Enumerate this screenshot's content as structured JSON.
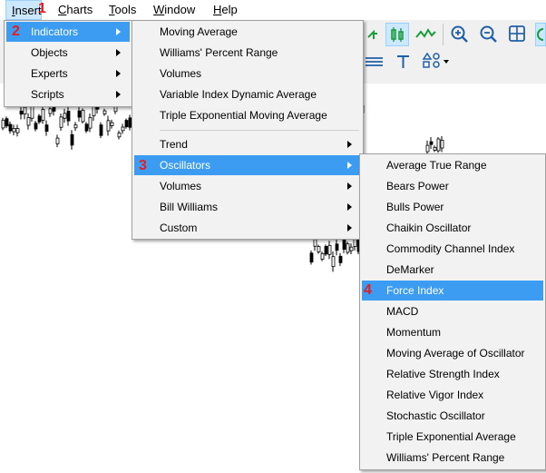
{
  "menubar": {
    "items": [
      {
        "first": "I",
        "rest": "nsert"
      },
      {
        "first": "C",
        "rest": "harts"
      },
      {
        "first": "T",
        "rest": "ools"
      },
      {
        "first": "W",
        "rest": "indow"
      },
      {
        "first": "H",
        "rest": "elp"
      }
    ]
  },
  "steps": [
    "1",
    "2",
    "3",
    "4"
  ],
  "insert_menu": {
    "items": [
      "Indicators",
      "Objects",
      "Experts",
      "Scripts"
    ]
  },
  "indicators_menu": {
    "top_items": [
      "Moving Average",
      "Williams' Percent Range",
      "Volumes",
      "Variable Index Dynamic Average",
      "Triple Exponential Moving Average"
    ],
    "group_items": [
      "Trend",
      "Oscillators",
      "Volumes",
      "Bill Williams",
      "Custom"
    ]
  },
  "oscillators_menu": {
    "items": [
      "Average True Range",
      "Bears Power",
      "Bulls Power",
      "Chaikin Oscillator",
      "Commodity Channel Index",
      "DeMarker",
      "Force Index",
      "MACD",
      "Momentum",
      "Moving Average of Oscillator",
      "Relative Strength Index",
      "Relative Vigor Index",
      "Stochastic Oscillator",
      "Triple Exponential Average",
      "Williams' Percent Range"
    ]
  },
  "toolbar": {
    "icons": [
      "candlestick-icon",
      "line-chart-icon",
      "zoom-in-icon",
      "zoom-out-icon",
      "grid-icon",
      "horizontal-lines-icon",
      "text-tool-icon",
      "shapes-icon"
    ]
  },
  "colors": {
    "highlight": "#3c9cf2",
    "step_marker": "#e81c1c",
    "menu_bg": "#f2f2f2",
    "active_button": "#cce8ff"
  }
}
